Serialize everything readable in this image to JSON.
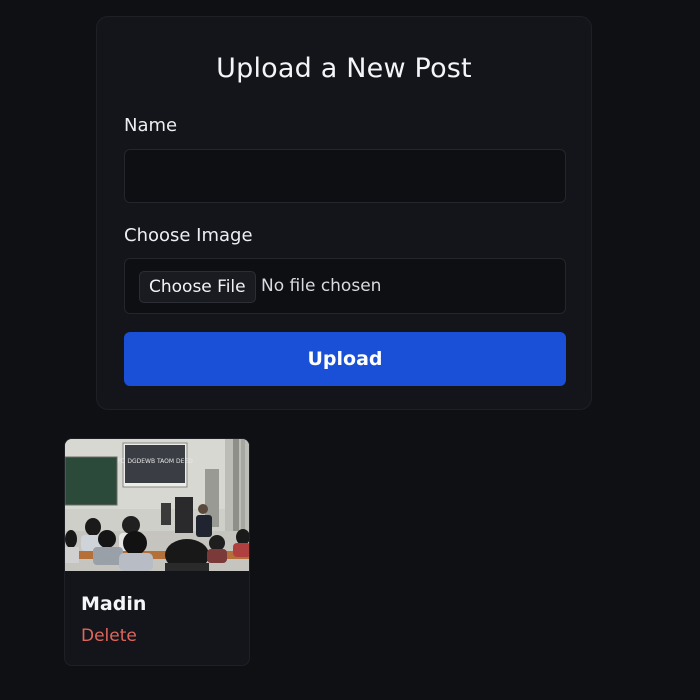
{
  "upload_form": {
    "title": "Upload a New Post",
    "name_label": "Name",
    "name_value": "",
    "image_label": "Choose Image",
    "choose_file_label": "Choose File",
    "file_status": "No file chosen",
    "upload_label": "Upload"
  },
  "posts": [
    {
      "name": "Madin",
      "delete_label": "Delete",
      "image_icon": "classroom-photo",
      "slide_text": "PD DGDEWB TAOM DEED"
    }
  ],
  "colors": {
    "background": "#0f1014",
    "card": "#14151a",
    "primary": "#1a4fd8",
    "danger": "#e0665c"
  }
}
